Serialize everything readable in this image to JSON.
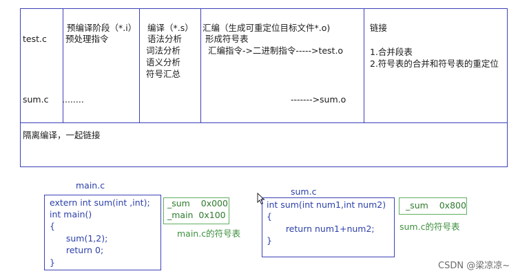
{
  "table": {
    "row_labels": [
      "test.c",
      "sum.c"
    ],
    "col2": [
      "预编译阶段（*.i）",
      "预处理指令"
    ],
    "col2_sum": "........",
    "col3": [
      "编译（*.s）",
      " 语法分析",
      "词法分析",
      "语义分析",
      "符号汇总"
    ],
    "col4": [
      "汇编（生成可重定位目标文件*.o)",
      " 形成符号表",
      "  汇编指令->二进制指令----->test.o"
    ],
    "col4_sum": "------->sum.o",
    "col5": [
      "链接",
      "",
      "",
      "1.合并段表",
      "2.符号表的合并和符号表的重定位"
    ],
    "footer": "隔离编译，一起链接"
  },
  "main_file": {
    "title": "main.c",
    "code": [
      "extern int sum(int ,int);",
      "int main()",
      "{",
      "      sum(1,2);",
      "      return 0;",
      "}"
    ],
    "symbols": [
      "_sum    0x000",
      "_main  0x100"
    ],
    "symbol_caption": "main.c的符号表"
  },
  "sum_file": {
    "title": "sum.c",
    "code": [
      "int sum(int num1,int num2)",
      "{",
      "       return num1+num2;",
      "}"
    ],
    "symbols": [
      " _sum    0x800"
    ],
    "symbol_caption": "sum.c的符号表"
  },
  "watermark": "CSDN @梁凉凉~",
  "colors": {
    "table_border": "#3b3fb5",
    "code_text": "#2b3fa8",
    "symbol_border": "#5fae5f",
    "symbol_text": "#3d8f3d"
  }
}
